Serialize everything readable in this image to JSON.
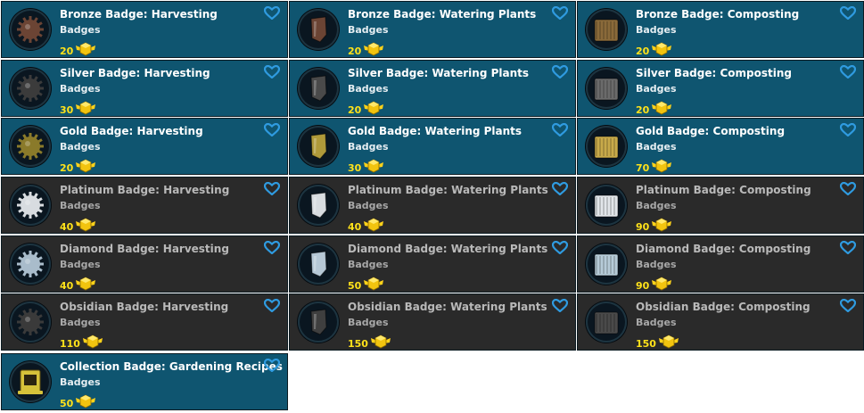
{
  "colors": {
    "owned_bg": "#0f5570",
    "unowned_bg": "#2a2a2a",
    "heart": "#2f9be0",
    "points": "#ffe21a"
  },
  "badges": [
    {
      "title": "Bronze Badge: Harvesting",
      "category": "Badges",
      "points": "20",
      "owned": true,
      "icon": "harvesting-badge-icon",
      "tint": "#6b4434"
    },
    {
      "title": "Bronze Badge: Watering Plants",
      "category": "Badges",
      "points": "20",
      "owned": true,
      "icon": "watering-plants-badge-icon",
      "tint": "#6b4434"
    },
    {
      "title": "Bronze Badge: Composting",
      "category": "Badges",
      "points": "20",
      "owned": true,
      "icon": "composting-badge-icon",
      "tint": "#8a6a3a"
    },
    {
      "title": "Silver Badge: Harvesting",
      "category": "Badges",
      "points": "30",
      "owned": true,
      "icon": "harvesting-badge-icon",
      "tint": "#3b3b3b"
    },
    {
      "title": "Silver Badge: Watering Plants",
      "category": "Badges",
      "points": "20",
      "owned": true,
      "icon": "watering-plants-badge-icon",
      "tint": "#4a4a4a"
    },
    {
      "title": "Silver Badge: Composting",
      "category": "Badges",
      "points": "20",
      "owned": true,
      "icon": "composting-badge-icon",
      "tint": "#6b6b6b"
    },
    {
      "title": "Gold Badge: Harvesting",
      "category": "Badges",
      "points": "20",
      "owned": true,
      "icon": "harvesting-badge-icon",
      "tint": "#8a7a2a"
    },
    {
      "title": "Gold Badge: Watering Plants",
      "category": "Badges",
      "points": "30",
      "owned": true,
      "icon": "watering-plants-badge-icon",
      "tint": "#b09a3a"
    },
    {
      "title": "Gold Badge: Composting",
      "category": "Badges",
      "points": "70",
      "owned": true,
      "icon": "composting-badge-icon",
      "tint": "#c8aa4a"
    },
    {
      "title": "Platinum Badge: Harvesting",
      "category": "Badges",
      "points": "40",
      "owned": false,
      "icon": "harvesting-badge-icon",
      "tint": "#d8dce0"
    },
    {
      "title": "Platinum Badge: Watering Plants",
      "category": "Badges",
      "points": "40",
      "owned": false,
      "icon": "watering-plants-badge-icon",
      "tint": "#d8dce0"
    },
    {
      "title": "Platinum Badge: Composting",
      "category": "Badges",
      "points": "90",
      "owned": false,
      "icon": "composting-badge-icon",
      "tint": "#e2e6ea"
    },
    {
      "title": "Diamond Badge: Harvesting",
      "category": "Badges",
      "points": "40",
      "owned": false,
      "icon": "harvesting-badge-icon",
      "tint": "#a9bccb"
    },
    {
      "title": "Diamond Badge: Watering Plants",
      "category": "Badges",
      "points": "50",
      "owned": false,
      "icon": "watering-plants-badge-icon",
      "tint": "#b6c8d6"
    },
    {
      "title": "Diamond Badge: Composting",
      "category": "Badges",
      "points": "90",
      "owned": false,
      "icon": "composting-badge-icon",
      "tint": "#b6cbd8"
    },
    {
      "title": "Obsidian Badge: Harvesting",
      "category": "Badges",
      "points": "110",
      "owned": false,
      "icon": "harvesting-badge-icon",
      "tint": "#3a3a3a"
    },
    {
      "title": "Obsidian Badge: Watering Plants",
      "category": "Badges",
      "points": "150",
      "owned": false,
      "icon": "watering-plants-badge-icon",
      "tint": "#3f3f3f"
    },
    {
      "title": "Obsidian Badge: Composting",
      "category": "Badges",
      "points": "150",
      "owned": false,
      "icon": "composting-badge-icon",
      "tint": "#4a4a4a"
    },
    {
      "title": "Collection Badge: Gardening Recipes",
      "category": "Badges",
      "points": "50",
      "owned": true,
      "icon": "collection-badge-icon",
      "tint": "#d6c23a"
    }
  ]
}
